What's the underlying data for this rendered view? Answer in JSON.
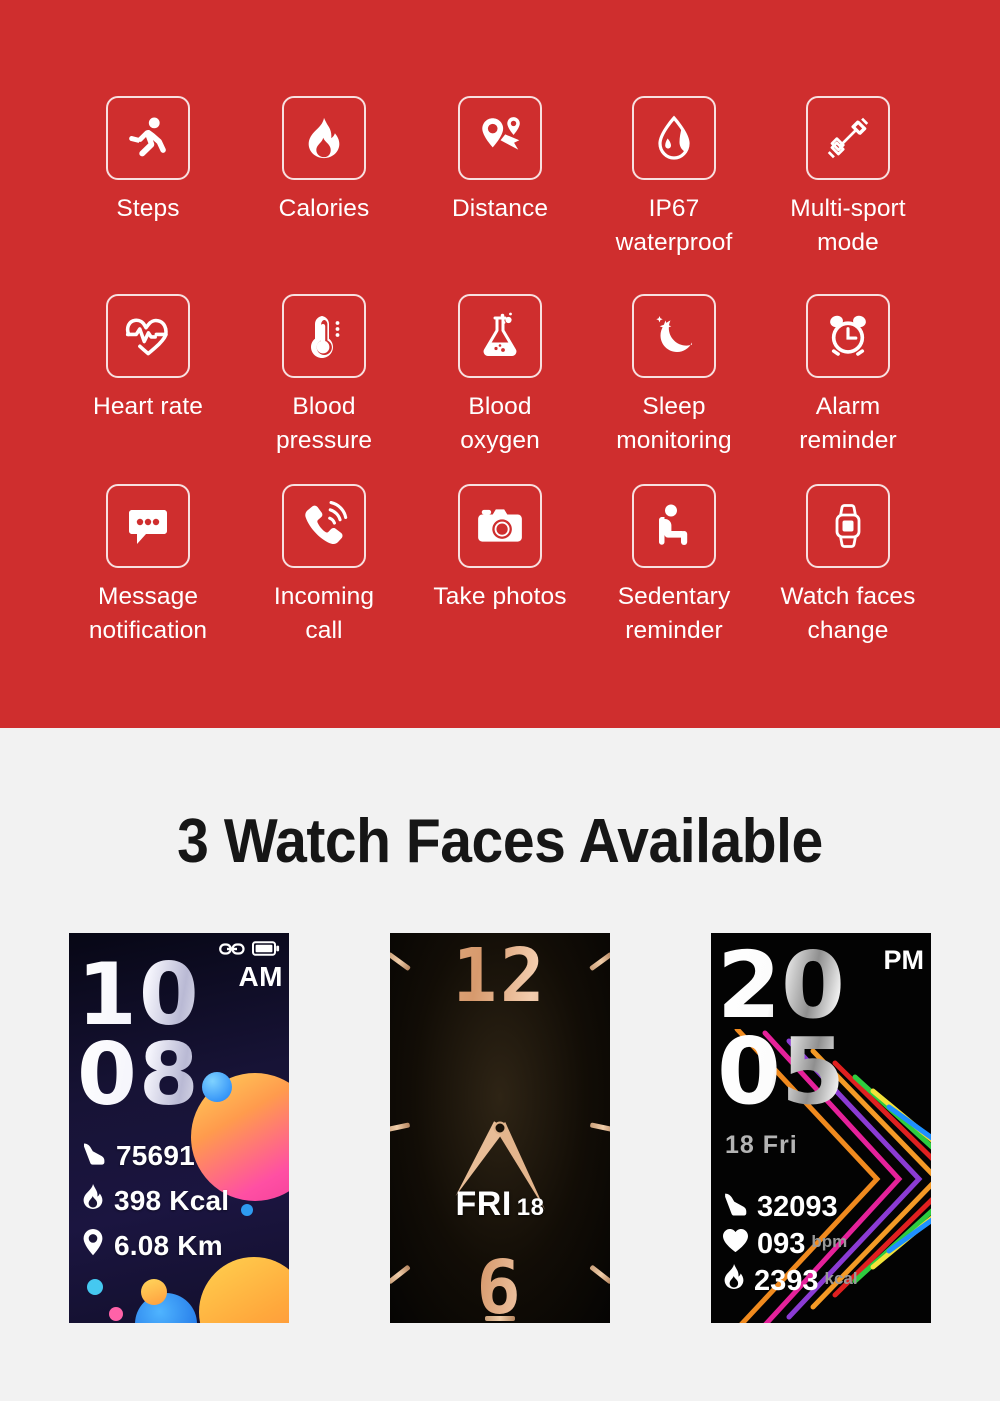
{
  "features_section": {
    "background_color": "#cf2e2e",
    "rows": [
      [
        {
          "label": "Steps",
          "icon": "running-person-icon"
        },
        {
          "label": "Calories",
          "icon": "flame-icon"
        },
        {
          "label": "Distance",
          "icon": "map-pin-route-icon"
        },
        {
          "label": "IP67\nwaterproof",
          "icon": "water-drop-icon"
        },
        {
          "label": "Multi-sport\nmode",
          "icon": "dumbbell-icon"
        }
      ],
      [
        {
          "label": "Heart rate",
          "icon": "heart-pulse-icon"
        },
        {
          "label": "Blood\npressure",
          "icon": "thermometer-icon"
        },
        {
          "label": "Blood\noxygen",
          "icon": "flask-icon"
        },
        {
          "label": "Sleep\nmonitoring",
          "icon": "moon-stars-icon"
        },
        {
          "label": "Alarm\nreminder",
          "icon": "alarm-clock-icon"
        }
      ],
      [
        {
          "label": "Message\nnotification",
          "icon": "chat-bubble-icon"
        },
        {
          "label": "Incoming\ncall",
          "icon": "phone-ringing-icon"
        },
        {
          "label": "Take photos",
          "icon": "camera-icon"
        },
        {
          "label": "Sedentary\nreminder",
          "icon": "sitting-person-icon"
        },
        {
          "label": "Watch faces\nchange",
          "icon": "smartwatch-icon"
        }
      ]
    ]
  },
  "faces_section": {
    "title": "3 Watch Faces Available",
    "background_color": "#f2f2f2",
    "faces": [
      {
        "name": "digital-gradient-face",
        "hours": "10",
        "minutes": "08",
        "meridiem": "AM",
        "status_icons": [
          "link-icon",
          "battery-icon"
        ],
        "stats": [
          {
            "icon": "shoe-icon",
            "value": "75691",
            "unit": ""
          },
          {
            "icon": "flame-icon",
            "value": "398 Kcal",
            "unit": ""
          },
          {
            "icon": "location-pin-icon",
            "value": "6.08 Km",
            "unit": ""
          }
        ]
      },
      {
        "name": "analog-rose-gold-face",
        "top_numeral": "12",
        "bottom_numeral": "6",
        "weekday": "FRI",
        "day": "18"
      },
      {
        "name": "black-rainbow-face",
        "hours": "20",
        "minutes": "05",
        "meridiem": "PM",
        "date": "18 Fri",
        "stats": [
          {
            "icon": "shoe-icon",
            "value": "32093",
            "unit": ""
          },
          {
            "icon": "heart-icon",
            "value": "093",
            "unit": "bpm"
          },
          {
            "icon": "flame-icon",
            "value": "2393",
            "unit": "kcal"
          }
        ]
      }
    ]
  }
}
